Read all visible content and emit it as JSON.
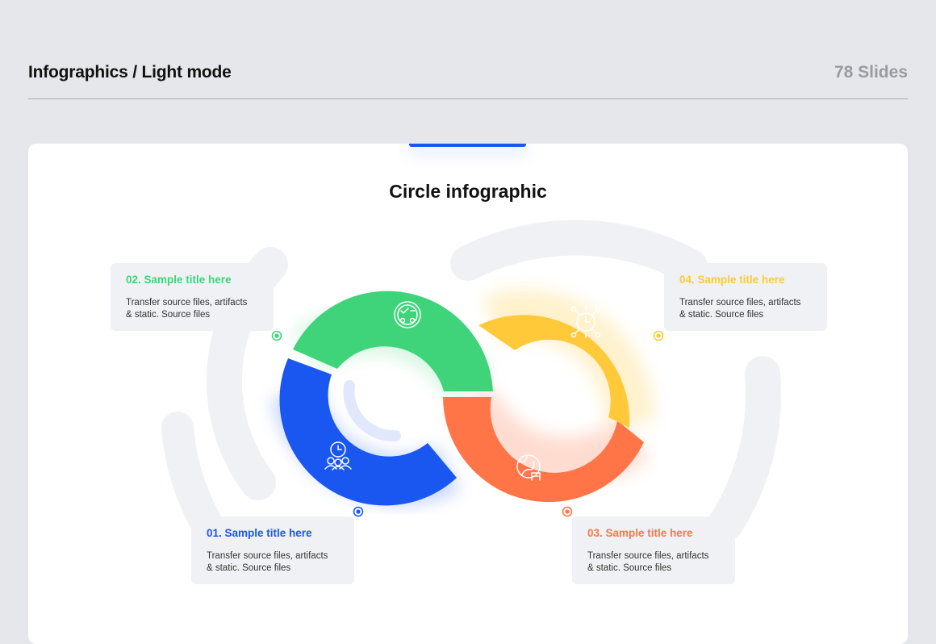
{
  "header": {
    "title": "Infographics / Light mode",
    "slide_count": "78 Slides"
  },
  "slide": {
    "title": "Circle infographic",
    "items": [
      {
        "title": "01. Sample title here",
        "desc_line1": "Transfer source files, artifacts",
        "desc_line2": "& static. Source files",
        "color": "#1a56f0",
        "icon": "team-clock-icon"
      },
      {
        "title": "02. Sample title here",
        "desc_line1": "Transfer source files, artifacts",
        "desc_line2": "& static. Source files",
        "color": "#3fd47a",
        "icon": "checklist-badge-icon"
      },
      {
        "title": "03. Sample title here",
        "desc_line1": "Transfer source files, artifacts",
        "desc_line2": "& static. Source files",
        "color": "#ff7547",
        "icon": "globe-building-icon"
      },
      {
        "title": "04. Sample title here",
        "desc_line1": "Transfer source files, artifacts",
        "desc_line2": "& static. Source files",
        "color": "#ffc93a",
        "icon": "network-clock-icon"
      }
    ]
  }
}
